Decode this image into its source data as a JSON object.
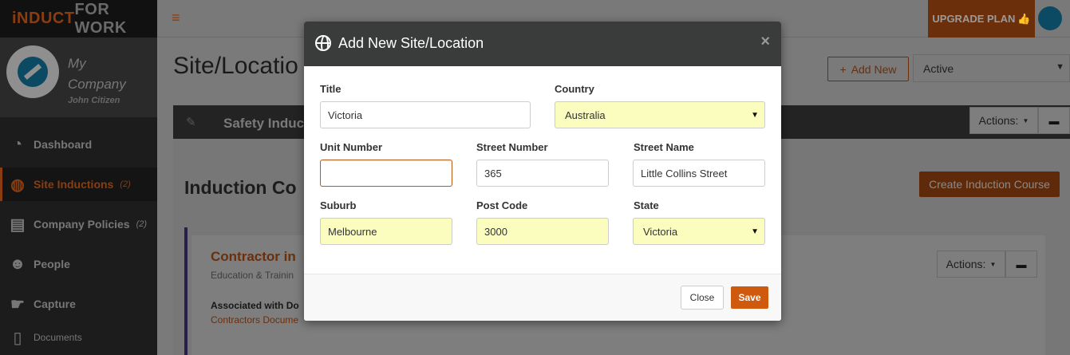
{
  "brand": {
    "logo_part1": "iNDUCT",
    "logo_part2": "FOR WORK"
  },
  "profile": {
    "company": "My Company",
    "user": "John Citizen"
  },
  "sidebar": {
    "items": [
      {
        "label": "Dashboard",
        "count": "",
        "icon": "speedometer-icon"
      },
      {
        "label": "Site Inductions",
        "count": "(2)",
        "icon": "globe-icon"
      },
      {
        "label": "Company Policies",
        "count": "(2)",
        "icon": "document-icon"
      },
      {
        "label": "People",
        "count": "",
        "icon": "users-icon"
      },
      {
        "label": "Capture",
        "count": "",
        "icon": "hand-icon"
      },
      {
        "label": "Documents",
        "count": "",
        "icon": "file-icon"
      }
    ]
  },
  "topbar": {
    "upgrade_label": "UPGRADE PLAN"
  },
  "page": {
    "title": "Site/Locatio",
    "add_new_label": "Add New",
    "status_value": "Active",
    "panel_title": "Safety Induc",
    "actions_label": "Actions:",
    "section_title": "Induction Co",
    "create_course_label": "Create Induction Course",
    "course_title": "Contractor in",
    "course_subtitle": "Education & Trainin",
    "associated_label": "Associated with Do",
    "associated_link": "Contractors Docume"
  },
  "modal": {
    "title": "Add New Site/Location",
    "close_x": "×",
    "fields": {
      "title": {
        "label": "Title",
        "value": "Victoria"
      },
      "country": {
        "label": "Country",
        "value": "Australia"
      },
      "unit_number": {
        "label": "Unit Number",
        "value": ""
      },
      "street_number": {
        "label": "Street Number",
        "value": "365"
      },
      "street_name": {
        "label": "Street Name",
        "value": "Little Collins Street"
      },
      "suburb": {
        "label": "Suburb",
        "value": "Melbourne"
      },
      "post_code": {
        "label": "Post Code",
        "value": "3000"
      },
      "state": {
        "label": "State",
        "value": "Victoria"
      }
    },
    "close_label": "Close",
    "save_label": "Save"
  },
  "colors": {
    "accent": "#cf5a0e",
    "modal_header": "#3a3b3b",
    "autofill": "#fbfdbe",
    "overlay": "#7a7a7a"
  }
}
